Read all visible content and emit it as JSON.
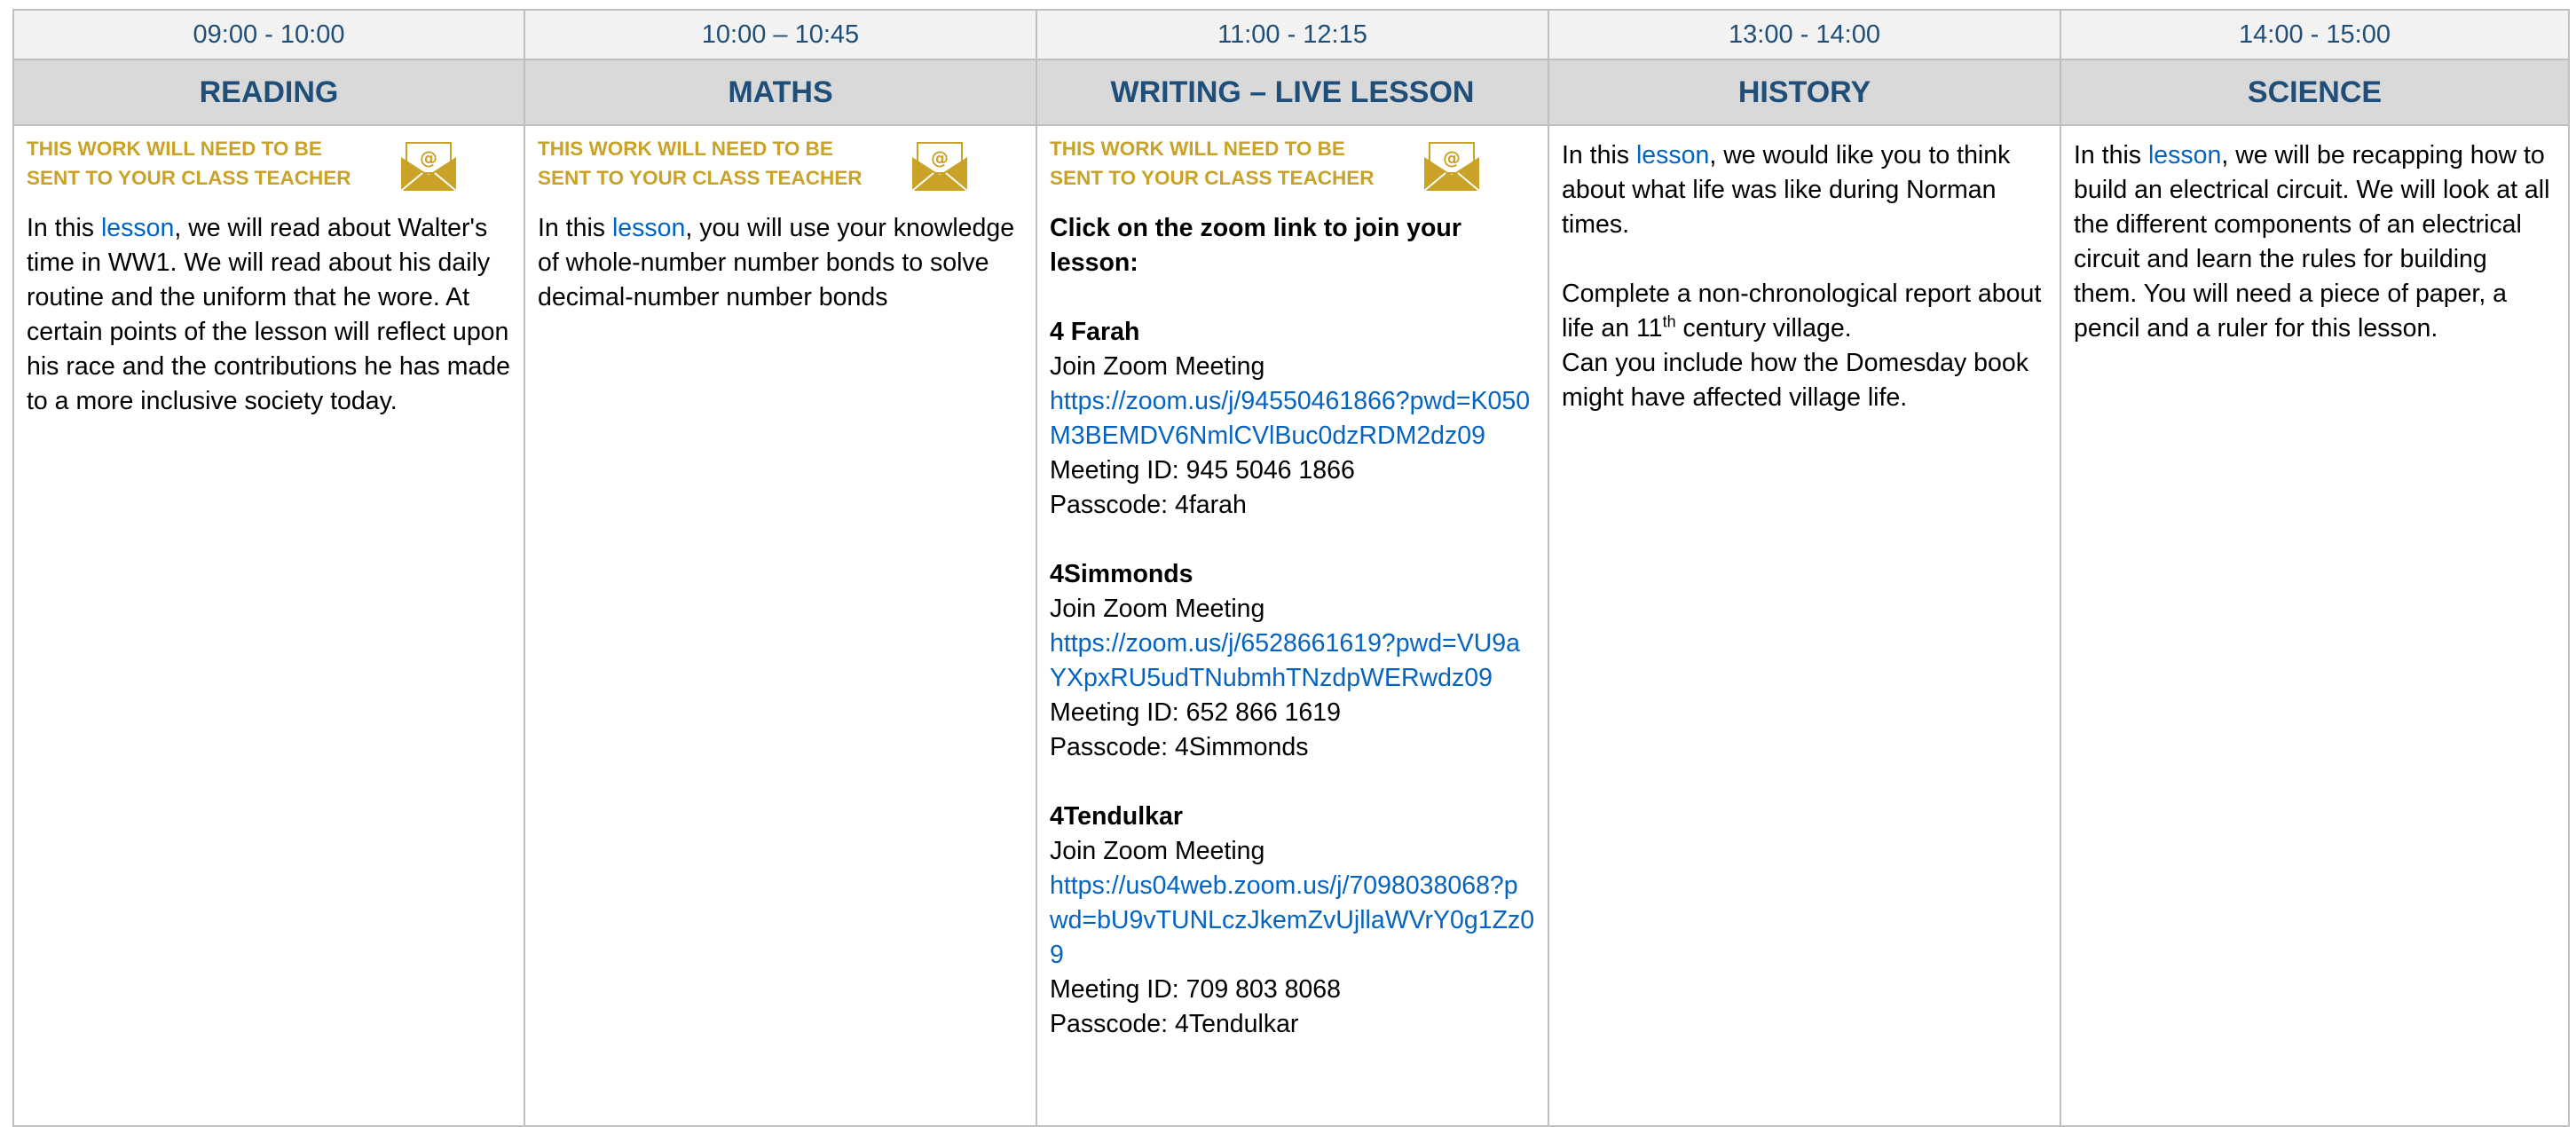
{
  "colors": {
    "heading_blue": "#1f4e79",
    "notice_gold": "#c9a227",
    "link_blue": "#0563c1",
    "time_row_bg": "#f2f2f2",
    "subject_row_bg": "#d9d9d9"
  },
  "icons": {
    "notice": "email-envelope-icon"
  },
  "notice_text": "THIS WORK WILL NEED TO BE SENT TO YOUR CLASS TEACHER",
  "columns": [
    {
      "time": "09:00 - 10:00",
      "subject": "READING"
    },
    {
      "time": "10:00 – 10:45",
      "subject": "MATHS"
    },
    {
      "time": "11:00 - 12:15",
      "subject": "WRITING – LIVE LESSON"
    },
    {
      "time": "13:00 - 14:00",
      "subject": "HISTORY"
    },
    {
      "time": "14:00 - 15:00",
      "subject": "SCIENCE"
    }
  ],
  "reading": {
    "pre": "In this ",
    "link": "lesson",
    "post": ", we will read about Walter's time in WW1. We will read about his daily routine and the uniform that he wore. At certain points of the lesson will reflect upon his race and the contributions he has made to a more inclusive society today."
  },
  "maths": {
    "pre": "In this ",
    "link": "lesson",
    "post": ", you will use your knowledge of whole-number number bonds to solve decimal-number number bonds"
  },
  "writing": {
    "intro": "Click on the zoom link to join your lesson:",
    "classes": [
      {
        "name": "4 Farah",
        "join": "Join Zoom Meeting",
        "url": "https://zoom.us/j/94550461866?pwd=K050M3BEMDV6NmlCVlBuc0dzRDM2dz09",
        "meeting_id": "Meeting ID: 945 5046 1866",
        "passcode": "Passcode: 4farah"
      },
      {
        "name": "4Simmonds",
        "join": "Join Zoom Meeting",
        "url": "https://zoom.us/j/6528661619?pwd=VU9aYXpxRU5udTNubmhTNzdpWERwdz09",
        "meeting_id": "Meeting ID: 652 866 1619",
        "passcode": "Passcode: 4Simmonds"
      },
      {
        "name": "4Tendulkar",
        "join": "Join Zoom Meeting",
        "url": "https://us04web.zoom.us/j/7098038068?pwd=bU9vTUNLczJkemZvUjllaWVrY0g1Zz09",
        "meeting_id": "Meeting ID: 709 803 8068",
        "passcode": "Passcode: 4Tendulkar"
      }
    ]
  },
  "history": {
    "p1_pre": "In this ",
    "p1_link": "lesson",
    "p1_post": ", we would like you to think about what life was like during Norman times.",
    "p2_pre": "Complete a non-chronological report about life an 11",
    "p2_sup": "th",
    "p2_post": " century village.",
    "p3": "Can you include how the Domesday book might have affected village life."
  },
  "science": {
    "pre": "In this ",
    "link": "lesson",
    "post": ", we will be recapping how to build an electrical circuit. We will look at all the different components of an electrical circuit and learn the rules for building them. You will need a piece of paper, a pencil and a ruler for this lesson."
  }
}
